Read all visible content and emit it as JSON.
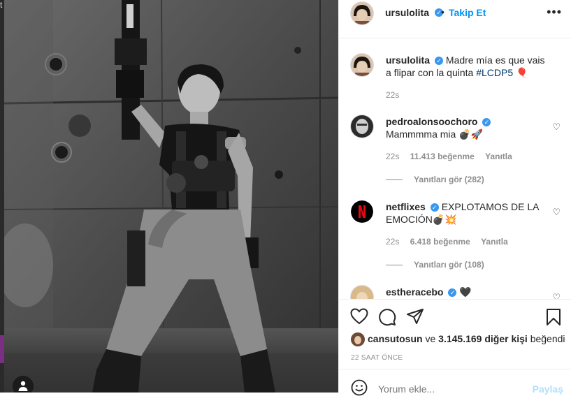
{
  "post": {
    "username": "ursulolita",
    "follow_label": "Takip Et",
    "separator": "•"
  },
  "caption": {
    "username": "ursulolita",
    "text": "Madre mía es que vais a flipar con la quinta ",
    "hashtag": "#LCDP5",
    "emoji": "🎈",
    "time": "22s"
  },
  "comments": [
    {
      "username": "pedroalonsoochoro",
      "text": "Mammmma mia 💣🚀",
      "time": "22s",
      "likes": "11.413 beğenme",
      "reply_label": "Yanıtla",
      "view_replies": "Yanıtları gör (282)"
    },
    {
      "username": "netflixes",
      "text": "EXPLOTAMOS DE LA EMOCIÓN💣💥",
      "time": "22s",
      "likes": "6.418 beğenme",
      "reply_label": "Yanıtla",
      "view_replies": "Yanıtları gör (108)"
    },
    {
      "username": "estheracebo",
      "text": "🖤"
    }
  ],
  "likes": {
    "first_user": "cansutosun",
    "connector": "ve",
    "others": "3.145.169 diğer kişi",
    "suffix": "beğendi"
  },
  "date": "22 SAAT ÖNCE",
  "add_comment": {
    "placeholder": "Yorum ekle...",
    "post_label": "Paylaş"
  },
  "colors": {
    "accent": "#0095f6",
    "verified": "#3897f0",
    "netflix": "#e50914",
    "muted": "#8e8e8e"
  },
  "backdrop_text": "t"
}
